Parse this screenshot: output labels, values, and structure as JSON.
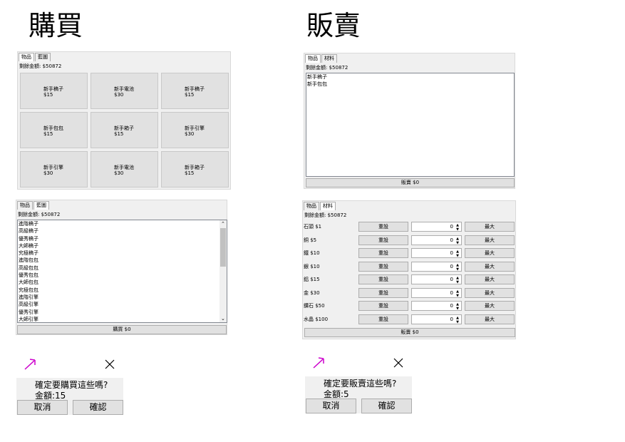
{
  "buy": {
    "title": "購買",
    "shop": {
      "tabs": [
        "物品",
        "藍圖"
      ],
      "balance": "剩餘金額: $50872",
      "items": [
        {
          "name": "新手稿子",
          "price": "$15"
        },
        {
          "name": "新手電池",
          "price": "$30"
        },
        {
          "name": "新手稿子",
          "price": "$15"
        },
        {
          "name": "新手包包",
          "price": "$15"
        },
        {
          "name": "新手箱子",
          "price": "$15"
        },
        {
          "name": "新手引擎",
          "price": "$30"
        },
        {
          "name": "新手引擎",
          "price": "$30"
        },
        {
          "name": "新手電池",
          "price": "$30"
        },
        {
          "name": "新手箱子",
          "price": "$15"
        }
      ]
    },
    "blueprint": {
      "tabs": [
        "物品",
        "藍圖"
      ],
      "balance": "剩餘金額: $50872",
      "list": [
        "進階稿子",
        "高級稿子",
        "優秀稿子",
        "大師稿子",
        "究極稿子",
        "進階包包",
        "高級包包",
        "優秀包包",
        "大師包包",
        "究極包包",
        "進階引擎",
        "高級引擎",
        "優秀引擎",
        "大師引擎"
      ],
      "buy_button": "購買 $0"
    },
    "dialog": {
      "question": "確定要購買這些嗎?",
      "amount": "金額:15",
      "cancel": "取消",
      "confirm": "確認"
    }
  },
  "sell": {
    "title": "販賣",
    "items_panel": {
      "tabs": [
        "物品",
        "材料"
      ],
      "balance": "剩餘金額: $50872",
      "list": [
        "新手稿子",
        "新手包包"
      ],
      "sell_button": "販賣 $0"
    },
    "materials_panel": {
      "tabs": [
        "物品",
        "材料"
      ],
      "balance": "剩餘金額: $50872",
      "materials": [
        {
          "label": "石頭 $1",
          "reset": "重設",
          "qty": "0",
          "max": "最大"
        },
        {
          "label": "銅 $5",
          "reset": "重設",
          "qty": "0",
          "max": "最大"
        },
        {
          "label": "鐵 $10",
          "reset": "重設",
          "qty": "0",
          "max": "最大"
        },
        {
          "label": "銀 $10",
          "reset": "重設",
          "qty": "0",
          "max": "最大"
        },
        {
          "label": "鋁 $15",
          "reset": "重設",
          "qty": "0",
          "max": "最大"
        },
        {
          "label": "金 $30",
          "reset": "重設",
          "qty": "0",
          "max": "最大"
        },
        {
          "label": "鑽石 $50",
          "reset": "重設",
          "qty": "0",
          "max": "最大"
        },
        {
          "label": "水晶 $100",
          "reset": "重設",
          "qty": "0",
          "max": "最大"
        }
      ],
      "sell_button": "販賣 $0"
    },
    "dialog": {
      "question": "確定要販賣這些嗎?",
      "amount": "金額:5",
      "cancel": "取消",
      "confirm": "確認"
    }
  },
  "icons": {
    "pickaxe": "pickaxe-icon",
    "close": "close-icon"
  },
  "colors": {
    "pickaxe_accent": "#cc00cc",
    "panel_bg": "#f0f0f0",
    "button_bg": "#e1e1e1"
  }
}
